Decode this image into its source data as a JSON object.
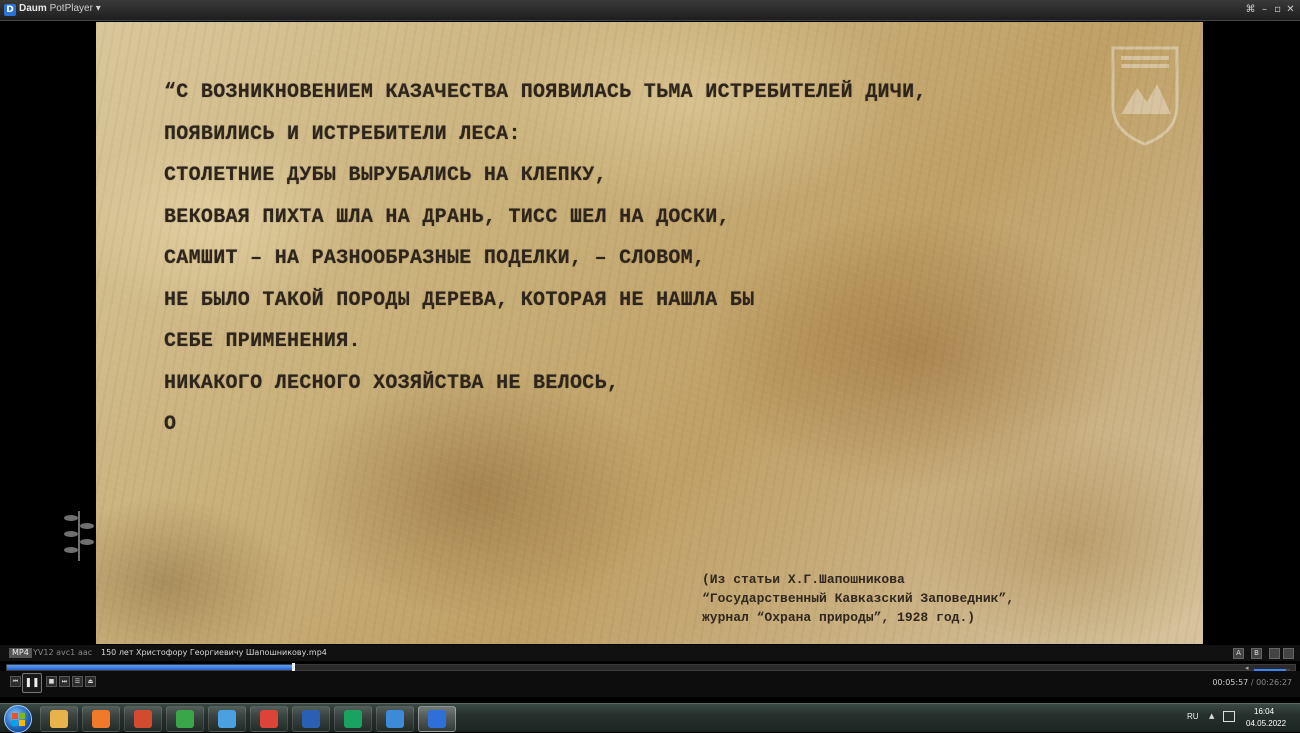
{
  "window": {
    "logo_letter": "D",
    "title_main": "Daum",
    "title_sub": "PotPlayer",
    "menu_arrow": "▾",
    "buttons": {
      "pin": "⌘",
      "minimize": "–",
      "maximize": "▫",
      "close": "✕"
    }
  },
  "video": {
    "quote_lines": [
      "“С ВОЗНИКНОВЕНИЕМ КАЗАЧЕСТВА ПОЯВИЛАСЬ ТЬМА ИСТРЕБИТЕЛЕЙ ДИЧИ,",
      "ПОЯВИЛИСЬ И ИСТРЕБИТЕЛИ ЛЕСА:",
      "СТОЛЕТНИЕ ДУБЫ ВЫРУБАЛИСЬ НА КЛЕПКУ,",
      "ВЕКОВАЯ ПИХТА ШЛА НА ДРАНЬ, ТИСС ШЕЛ НА ДОСКИ,",
      "САМШИТ – НА РАЗНООБРАЗНЫЕ ПОДЕЛКИ, – СЛОВОМ,",
      "НЕ БЫЛО ТАКОЙ ПОРОДЫ ДЕРЕВА, КОТОРАЯ НЕ НАШЛА БЫ",
      "СЕБЕ ПРИМЕНЕНИЯ.",
      "НИКАКОГО ЛЕСНОГО ХОЗЯЙСТВА НЕ ВЕЛОСЬ,",
      "О"
    ],
    "source_lines": [
      "(Из статьи Х.Г.Шапошникова",
      "“Государственный Кавказский Заповедник”,",
      "журнал “Охрана природы”, 1928 год.)"
    ]
  },
  "infobar": {
    "format": "MP4",
    "video_codec": "YV12 avc1",
    "audio_codec": "aac",
    "filename": "150 лет Христофору Георгиевичу Шапошникову.mp4",
    "right_buttons": [
      "A",
      "B"
    ]
  },
  "playback": {
    "progress": 0.2218,
    "volume": 0.9,
    "current_time": "00:05:57",
    "separator": " / ",
    "total_time": "00:26:27",
    "buttons": {
      "prev": "⏮",
      "play_pause": "❚❚",
      "stop": "■",
      "step": "⏭",
      "playlist": "☰",
      "open": "⏏"
    }
  },
  "taskbar": {
    "apps": [
      {
        "name": "explorer",
        "color": "#e8b34a"
      },
      {
        "name": "media-player",
        "color": "#f0792a"
      },
      {
        "name": "eye-app",
        "color": "#d34b2e"
      },
      {
        "name": "green-app",
        "color": "#3aa64a"
      },
      {
        "name": "paint",
        "color": "#4aa0e0"
      },
      {
        "name": "chrome",
        "color": "#db4437"
      },
      {
        "name": "word",
        "color": "#2b5fb4"
      },
      {
        "name": "chrome-profile",
        "color": "#1aa260"
      },
      {
        "name": "screen-app",
        "color": "#3c8ad8"
      },
      {
        "name": "potplayer",
        "color": "#2f6fd8",
        "active": true
      }
    ],
    "lang": "RU",
    "tray_arrow": "▲",
    "clock_time": "16:04",
    "clock_date": "04.05.2022"
  }
}
